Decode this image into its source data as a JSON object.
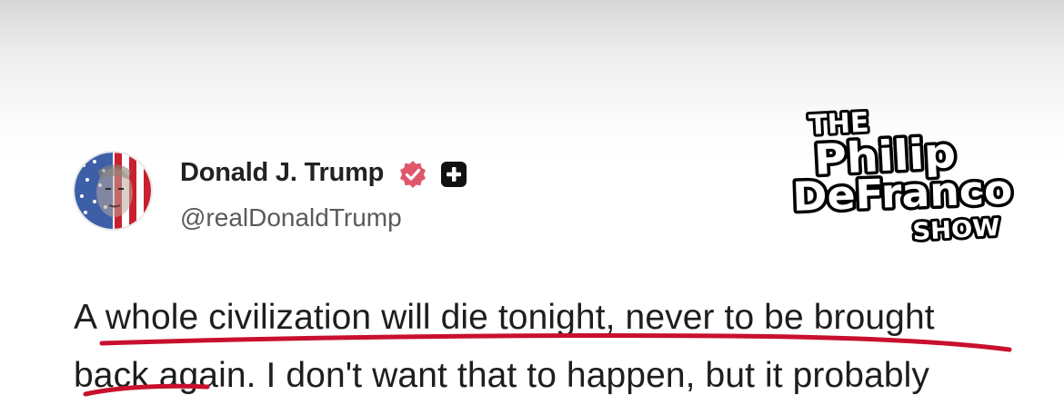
{
  "author": {
    "display_name": "Donald J. Trump",
    "handle": "@realDonaldTrump",
    "verified_icon": "verified-badge-icon",
    "plus_icon": "plus-badge-icon"
  },
  "overlay": {
    "logo_line_1": "THE",
    "logo_line_2": "Philip",
    "logo_line_3": "DeFranco",
    "logo_line_4": "SHOW"
  },
  "post": {
    "line_1": "A whole civilization will die tonight, never to be brought",
    "line_2": "back again. I don't want that to happen, but it probably"
  },
  "colors": {
    "verified_badge": "#e0566b",
    "underline": "#c8102e",
    "text": "#1e1e1e"
  }
}
